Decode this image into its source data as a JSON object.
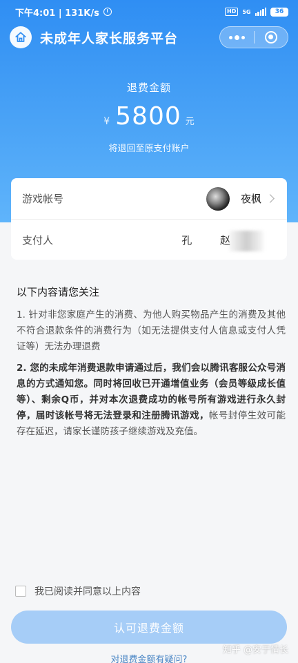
{
  "status_bar": {
    "time_speed": "下午4:01 | 131K/s",
    "hd": "HD",
    "network": "5G",
    "battery": "36"
  },
  "nav": {
    "title": "未成年人家长服务平台"
  },
  "refund": {
    "label": "退费金额",
    "currency_symbol": "¥",
    "amount": "5800",
    "unit": "元",
    "sub": "将退回至原支付账户"
  },
  "account_card": {
    "game_account_label": "游戏帐号",
    "nickname": "夜枫",
    "payer_label": "支付人",
    "payer_name": "孔 赵"
  },
  "notice": {
    "title": "以下内容请您关注",
    "item1": "1. 针对非您家庭产生的消费、为他人购买物品产生的消费及其他不符合退款条件的消费行为（如无法提供支付人信息或支付人凭证等）无法办理退费",
    "item2_bold": "2. 您的未成年消费退款申请通过后，我们会以腾讯客服公众号消息的方式通知您。同时将回收已开通增值业务（会员等级成长值等）、剩余Q币，并对本次退费成功的帐号所有游戏进行永久封停，届时该帐号将无法登录和注册腾讯游戏，",
    "item2_rest": "帐号封停生效可能存在延迟，请家长谨防孩子继续游戏及充值。"
  },
  "agree": {
    "label": "我已阅读并同意以上内容"
  },
  "confirm_button": {
    "label": "认可退费金额"
  },
  "question_link": {
    "label": "对退费金额有疑问?"
  },
  "watermark": {
    "text": "知乎 @安于情长"
  },
  "colors": {
    "primary": "#2f8ef3",
    "button_disabled": "#a6cdf7",
    "link": "#4a86c5"
  }
}
